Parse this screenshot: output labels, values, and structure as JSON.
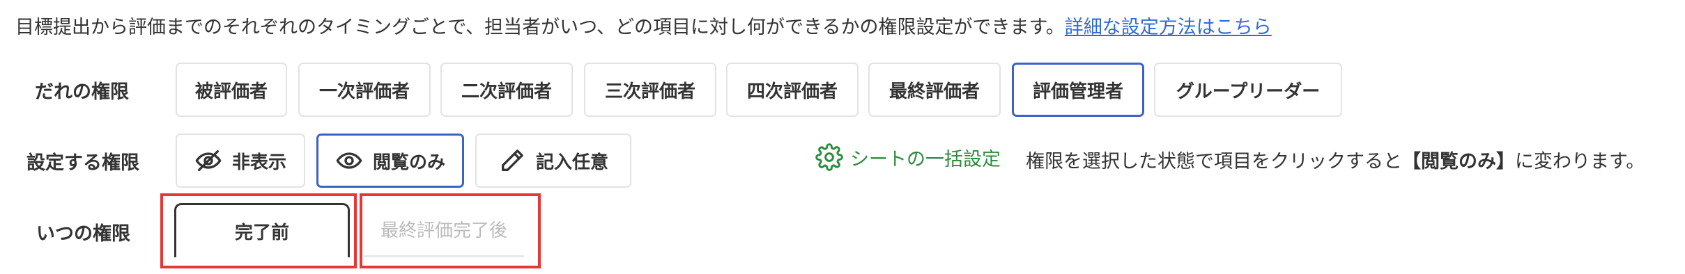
{
  "intro": {
    "text": "目標提出から評価までのそれぞれのタイミングごとで、担当者がいつ、どの項目に対し何ができるかの権限設定ができます。",
    "link": "詳細な設定方法はこちら"
  },
  "who": {
    "label": "だれの権限",
    "options": [
      "被評価者",
      "一次評価者",
      "二次評価者",
      "三次評価者",
      "四次評価者",
      "最終評価者",
      "評価管理者",
      "グループリーダー"
    ],
    "selected": "評価管理者"
  },
  "permission": {
    "label": "設定する権限",
    "options": [
      {
        "label": "非表示",
        "icon": "eye-slash-icon"
      },
      {
        "label": "閲覧のみ",
        "icon": "eye-icon"
      },
      {
        "label": "記入任意",
        "icon": "pencil-icon"
      }
    ],
    "selected": "閲覧のみ"
  },
  "bulk": {
    "label": "シートの一括設定",
    "icon": "gear-icon",
    "color": "#2e8b3e"
  },
  "hint": {
    "prefix": "権限を選択した状態で項目をクリックすると",
    "emphasis": "【閲覧のみ】",
    "suffix": "に変わります。"
  },
  "when": {
    "label": "いつの権限",
    "tabs": [
      "完了前",
      "最終評価完了後"
    ],
    "active": "完了前"
  },
  "colors": {
    "accent": "#3b63c4",
    "link": "#2f6bd6",
    "highlight": "#e53935"
  }
}
